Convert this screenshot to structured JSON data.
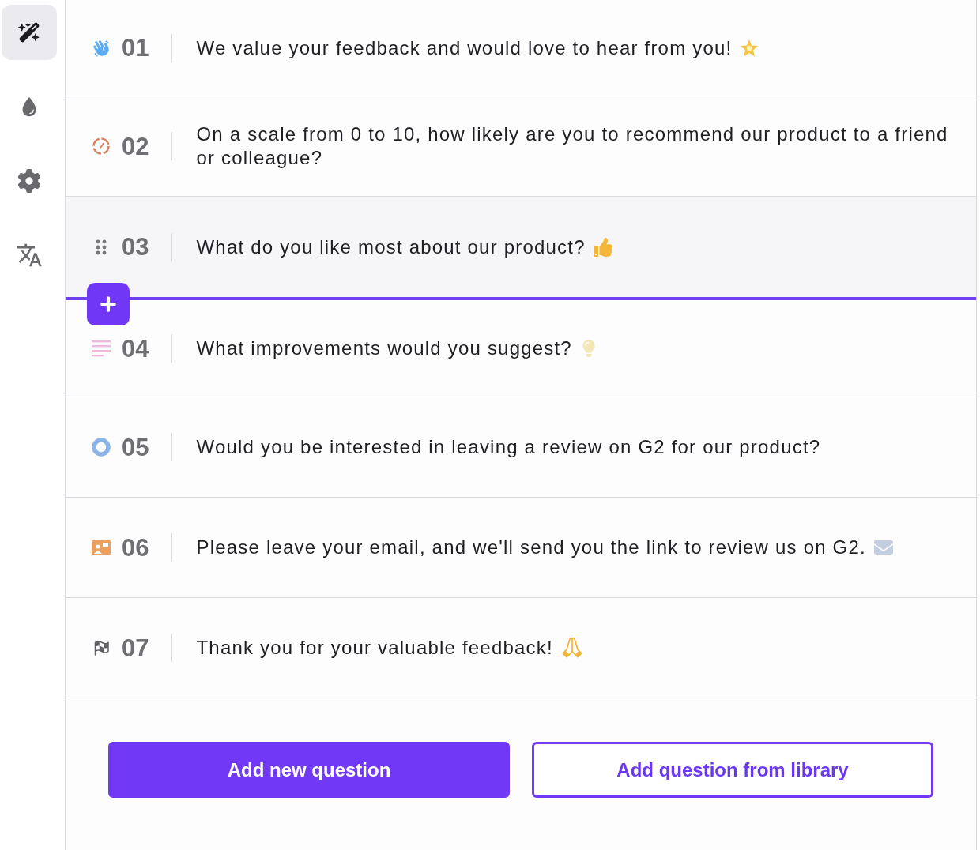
{
  "sidebar": {
    "items": [
      {
        "selected": true
      },
      {
        "selected": false
      },
      {
        "selected": false
      },
      {
        "selected": false
      }
    ]
  },
  "questions": [
    {
      "number": "01",
      "kind": "welcome",
      "hovered": false,
      "text": "We value your feedback and would love to hear from you!"
    },
    {
      "number": "02",
      "kind": "rating",
      "hovered": false,
      "text": "On a scale from 0 to 10, how likely are you to recommend our product to a friend or colleague?"
    },
    {
      "number": "03",
      "hovered": true,
      "text": "What do you like most about our product?"
    },
    {
      "number": "04",
      "kind": "long_text",
      "hovered": false,
      "text": "What improvements would you suggest?"
    },
    {
      "number": "05",
      "kind": "choice",
      "hovered": false,
      "text": "Would you be interested in leaving a review on G2 for our product?"
    },
    {
      "number": "06",
      "kind": "contact",
      "hovered": false,
      "text": "Please leave your email, and we'll send you the link to review us on G2."
    },
    {
      "number": "07",
      "kind": "ending",
      "hovered": false,
      "text": "Thank you for your valuable feedback!"
    }
  ],
  "actions": [
    {
      "label": "Add new question",
      "kind": "primary"
    },
    {
      "label": "Add question from library",
      "kind": "secondary"
    }
  ]
}
